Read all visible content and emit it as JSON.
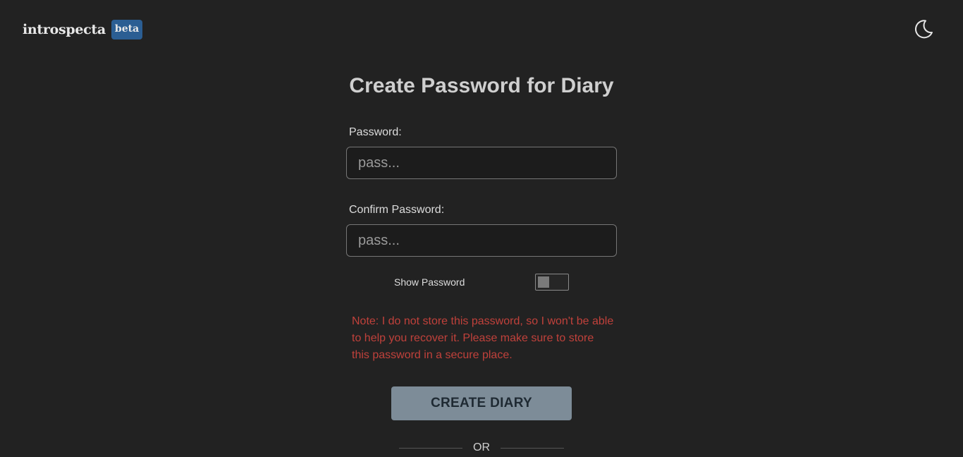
{
  "header": {
    "logo_text": "introspecta",
    "badge": "beta",
    "theme_icon": "moon-icon"
  },
  "form": {
    "title": "Create Password for Diary",
    "password_label": "Password:",
    "password_placeholder": "pass...",
    "confirm_label": "Confirm Password:",
    "confirm_placeholder": "pass...",
    "show_password_label": "Show Password",
    "show_password_on": false,
    "note": "Note: I do not store this password, so I won't be able to help you recover it. Please make sure to store this password in a secure place.",
    "submit_label": "CREATE DIARY",
    "divider_text": "OR"
  },
  "colors": {
    "background": "#222222",
    "note": "#c0413b",
    "button": "#7d8c98",
    "badge": "#2b5e93"
  }
}
